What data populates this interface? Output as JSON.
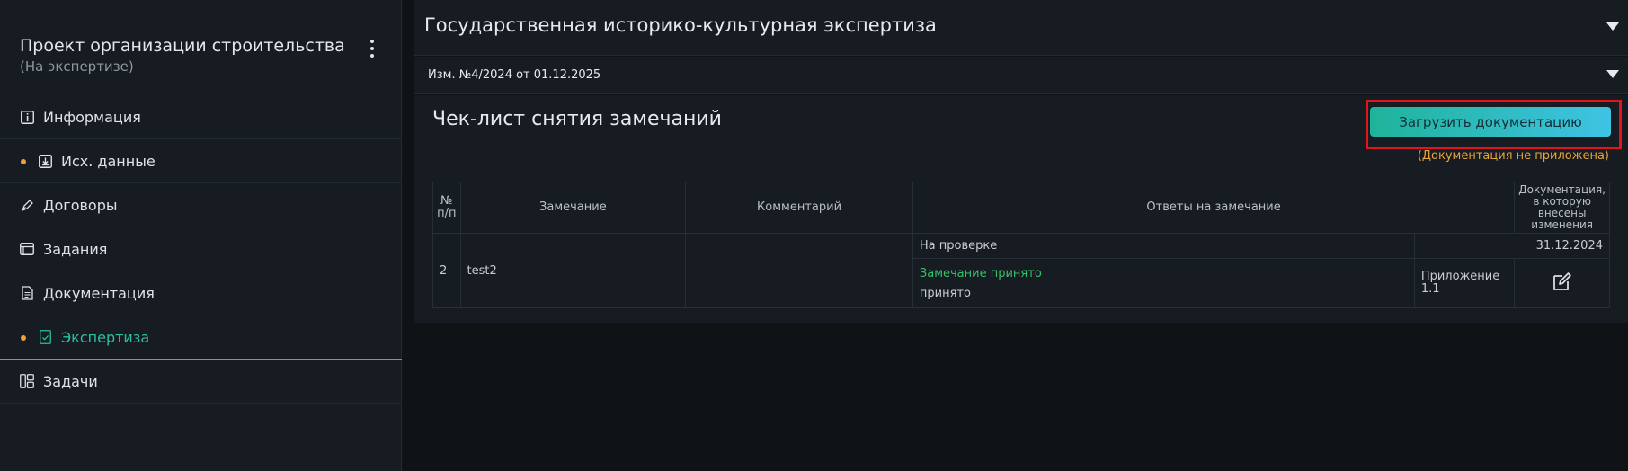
{
  "sidebar": {
    "project_title": "Проект организации строительства",
    "project_status": "(На экспертизе)",
    "items": [
      {
        "label": "Информация",
        "icon": "info-icon",
        "dot": false
      },
      {
        "label": "Исх. данные",
        "icon": "download-box-icon",
        "dot": true
      },
      {
        "label": "Договоры",
        "icon": "pen-icon",
        "dot": false
      },
      {
        "label": "Задания",
        "icon": "window-icon",
        "dot": false
      },
      {
        "label": "Документация",
        "icon": "document-icon",
        "dot": false
      },
      {
        "label": "Экспертиза",
        "icon": "check-document-icon",
        "dot": true,
        "active": true
      },
      {
        "label": "Задачи",
        "icon": "layout-icon",
        "dot": false
      }
    ]
  },
  "main": {
    "section_title": "Государственная историко-культурная экспертиза",
    "revision_title": "Изм. №4/2024 от 01.12.2025",
    "panel_title": "Чек-лист снятия замечаний",
    "upload_button": "Загрузить документацию",
    "upload_warning": "(Документация не приложена)",
    "table": {
      "headers": {
        "num": "№ п/п",
        "remark": "Замечание",
        "comment": "Комментарий",
        "answers": "Ответы на замечание",
        "docs": "Документация, в которую внесены изменения"
      },
      "row": {
        "num": "2",
        "remark": "test2",
        "comment": "",
        "check_status": "На проверке",
        "check_date": "31.12.2024",
        "answer_status": "Замечание принято",
        "answer_text": "принято",
        "doc_ref": "Приложение 1.1"
      }
    }
  },
  "colors": {
    "accent": "#2bbfa0",
    "warning": "#e8a43a",
    "approved": "#33c16a",
    "highlight_frame": "#e3141b"
  }
}
